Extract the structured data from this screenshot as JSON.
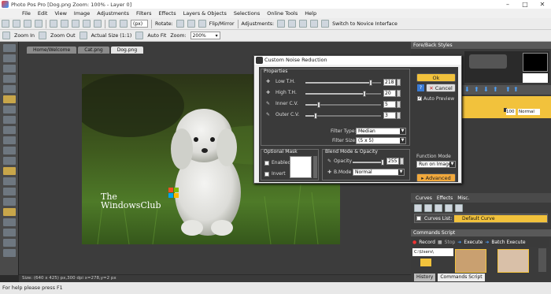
{
  "window": {
    "title": "Photo Pos Pro [Dog.png Zoom: 100% - Layer 0]"
  },
  "menu": [
    "File",
    "Edit",
    "View",
    "Image",
    "Adjustments",
    "Filters",
    "Effects",
    "Layers & Objects",
    "Selections",
    "Online Tools",
    "Help"
  ],
  "toolbar1": {
    "zoom_unit": "(px)",
    "rotate": "Rotate:",
    "flip": "Flip/Mirror",
    "adjustments": "Adjustments:",
    "novice": "Switch to Novice Interface"
  },
  "toolbar2": {
    "zoom_in": "Zoom In",
    "zoom_out": "Zoom Out",
    "actual_size": "Actual Size (1:1)",
    "auto_fit": "Auto Fit",
    "zoom_label": "Zoom:",
    "zoom_value": "200%"
  },
  "tabs": [
    "Home/Welcome",
    "Cat.png",
    "Dog.png"
  ],
  "status": "Size: (640 x 425) px,300 dpi   x=278,y=2 px",
  "help": "For help please press F1",
  "watermark": {
    "line1": "The",
    "line2": "WindowsClub"
  },
  "dialog": {
    "title": "Custom Noise Reduction",
    "properties_label": "Properties",
    "sliders": [
      {
        "label": "Low T.H.",
        "value": "218",
        "fraction": 0.86
      },
      {
        "label": "High T.H.",
        "value": "20",
        "fraction": 0.78
      },
      {
        "label": "Inner C.V.",
        "value": "5",
        "fraction": 0.18
      },
      {
        "label": "Outer C.V.",
        "value": "3",
        "fraction": 0.14
      }
    ],
    "filter_type_label": "Filter Type:",
    "filter_type": "Median",
    "filter_size_label": "Filter Size:",
    "filter_size": "(5 x 5)",
    "optional_mask": "Optional Mask",
    "enabled": "Enabled",
    "invert": "Invert",
    "blend_label": "Blend Mode & Opacity",
    "opacity_label": "Opacity",
    "opacity_value": "255",
    "bmode_label": "B.Mode",
    "bmode_value": "Normal",
    "ok": "Ok",
    "cancel": "Cancel",
    "auto_preview": "Auto Preview",
    "function_mode_label": "Function Mode",
    "function_mode": "Run on Image",
    "advanced": "Advanced"
  },
  "right": {
    "fore_back": "Fore/Back Styles",
    "layer_opacity": "100",
    "layer_mode": "Normal",
    "curves_tab": "Curves",
    "effects_tab": "Effects",
    "misc_tab": "Misc.",
    "curves_list": "Curves List:",
    "default_curve": "Default Curve",
    "commands_head": "Commands Script",
    "record": "Record",
    "stop": "Stop",
    "execute": "Execute",
    "batch": "Batch Execute",
    "path": "C:\\Users\\",
    "history_tab": "History",
    "commands_tab": "Commands Script"
  },
  "colors": {
    "accent": "#f2c23c",
    "panel": "#3b3b3b"
  }
}
